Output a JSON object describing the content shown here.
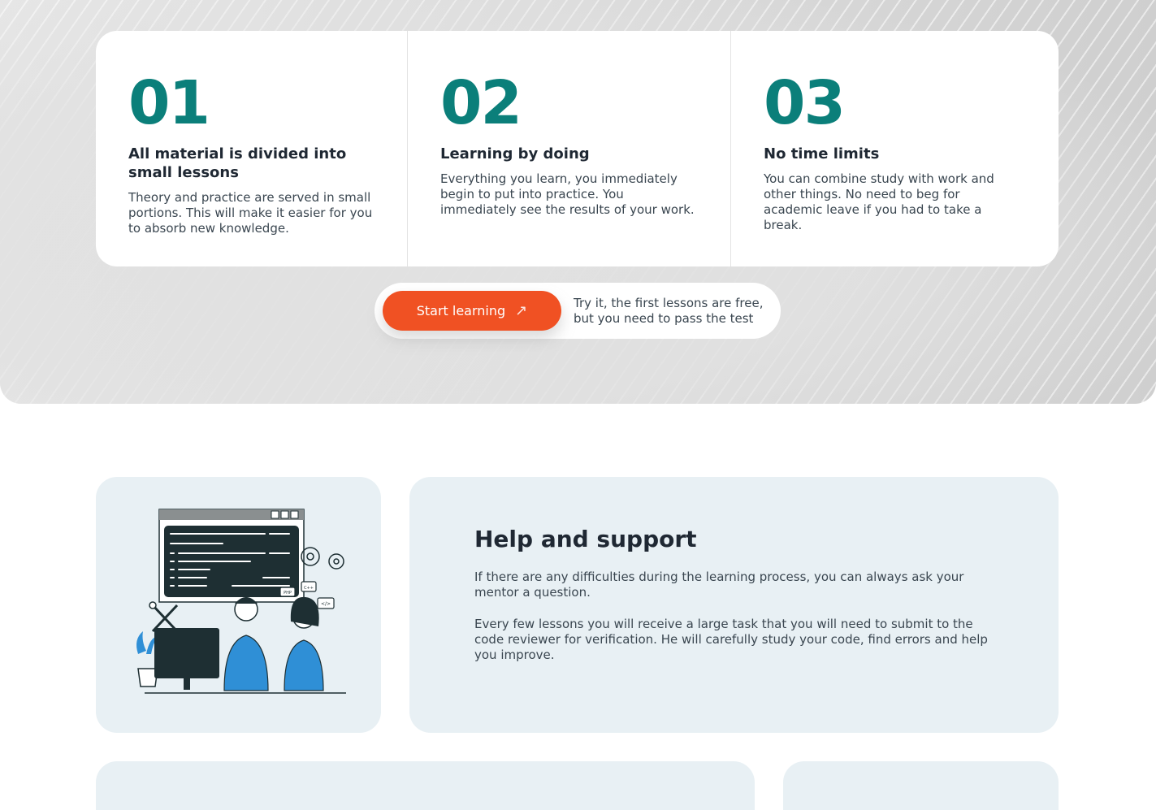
{
  "steps": [
    {
      "number": "01",
      "title": "All material is divided into small lessons",
      "text": "Theory and practice are served in small portions. This will make it easier for you to absorb new knowledge."
    },
    {
      "number": "02",
      "title": "Learning by doing",
      "text": "Everything you learn, you immediately begin to put into practice. You immediately see the results of your work."
    },
    {
      "number": "03",
      "title": "No time limits",
      "text": "You can combine study with work and other things. No need to beg for academic leave if you had to take a break."
    }
  ],
  "cta": {
    "button_label": "Start learning",
    "button_icon": "arrow-up-right-icon",
    "note": "Try it, the first lessons are free, but you need to pass the test"
  },
  "support": {
    "title": "Help and support",
    "paragraphs": [
      "If there are any difficulties during the learning process, you can always ask your mentor a question.",
      "Every few lessons you will receive a large task that you will need to submit to the code reviewer for verification. He will carefully study your code, find errors and help you improve."
    ],
    "illustration_labels": [
      "PHP",
      "C++",
      "</>"
    ]
  },
  "colors": {
    "accent": "#0b7f7a",
    "cta": "#f05123",
    "card_tint": "#e8f0f4",
    "illustration_blue": "#2f8fd6",
    "illustration_dark": "#1e2f33"
  }
}
